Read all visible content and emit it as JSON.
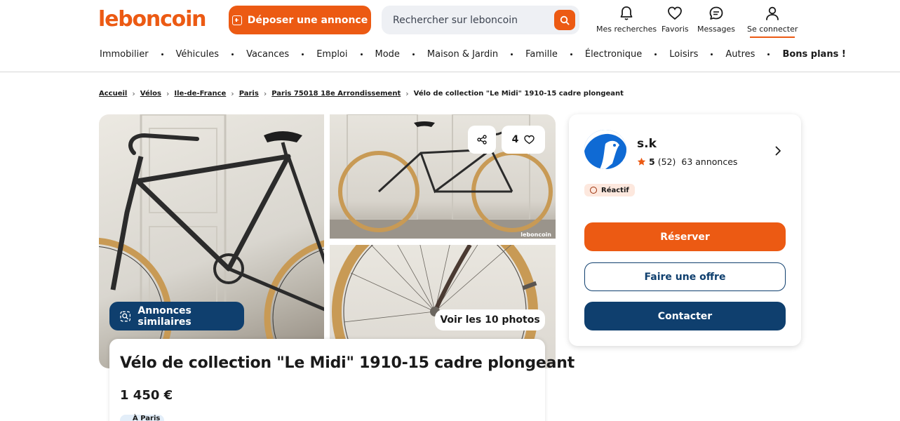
{
  "header": {
    "logo": "leboncoin",
    "post_ad": "Déposer une annonce",
    "search_placeholder": "Rechercher sur leboncoin",
    "nav": {
      "searches": "Mes recherches",
      "favorites": "Favoris",
      "messages": "Messages",
      "login": "Se connecter"
    }
  },
  "categories": [
    "Immobilier",
    "Véhicules",
    "Vacances",
    "Emploi",
    "Mode",
    "Maison & Jardin",
    "Famille",
    "Électronique",
    "Loisirs",
    "Autres",
    "Bons plans !"
  ],
  "breadcrumb": [
    "Accueil",
    "Vélos",
    "Ile-de-France",
    "Paris",
    "Paris 75018 18e Arrondissement",
    "Vélo de collection \"Le Midi\" 1910-15 cadre plongeant"
  ],
  "gallery": {
    "similar": "Annonces similaires",
    "favorites_count": "4",
    "view_photos": "Voir les 10 photos",
    "watermark": "leboncoin"
  },
  "listing": {
    "title": "Vélo de collection \"Le Midi\" 1910-15 cadre plongeant",
    "price": "1 450 €",
    "location_chip": "À Paris"
  },
  "seller": {
    "name": "s.k",
    "rating": "5",
    "reviews": "(52)",
    "ads": "63 annonces",
    "badge": "Réactif",
    "reserve": "Réserver",
    "offer": "Faire une offre",
    "contact": "Contacter"
  },
  "colors": {
    "brand_orange": "#ec5a13",
    "navy": "#0f3f6e"
  }
}
